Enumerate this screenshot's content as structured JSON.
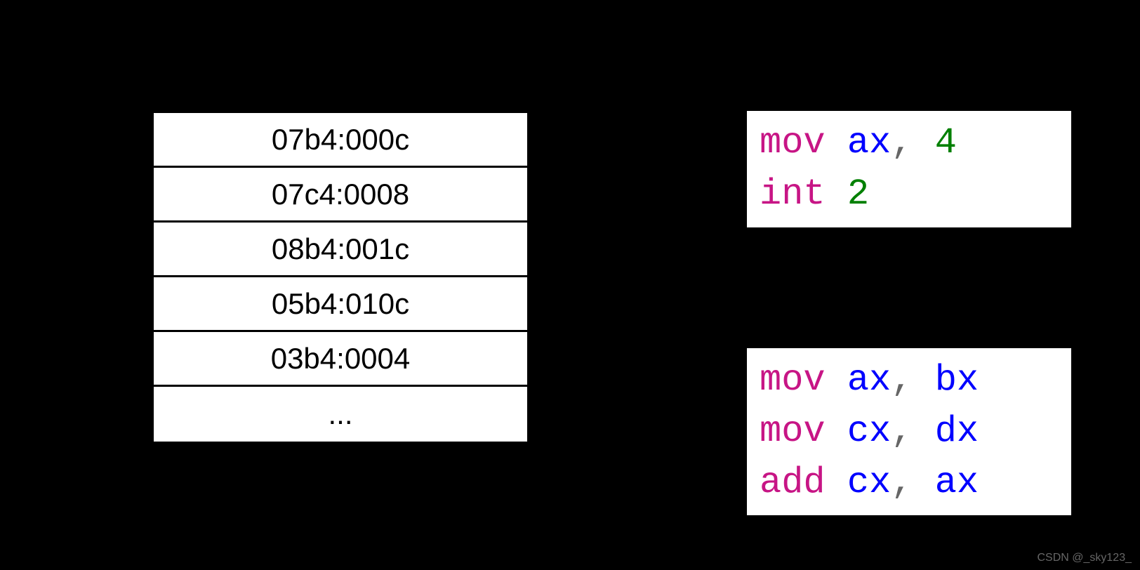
{
  "table": {
    "rows": [
      "07b4:000c",
      "07c4:0008",
      "08b4:001c",
      "05b4:010c",
      "03b4:0004",
      "..."
    ]
  },
  "code1": {
    "line1": {
      "op": "mov",
      "arg1": "ax",
      "comma": ",",
      "arg2": "4"
    },
    "line2": {
      "op": "int",
      "arg1": "2"
    }
  },
  "code2": {
    "line1": {
      "op": "mov",
      "arg1": "ax",
      "comma": ",",
      "arg2": "bx"
    },
    "line2": {
      "op": "mov",
      "arg1": "cx",
      "comma": ",",
      "arg2": "dx"
    },
    "line3": {
      "op": "add",
      "arg1": "cx",
      "comma": ",",
      "arg2": "ax"
    }
  },
  "watermark": "CSDN @_sky123_"
}
